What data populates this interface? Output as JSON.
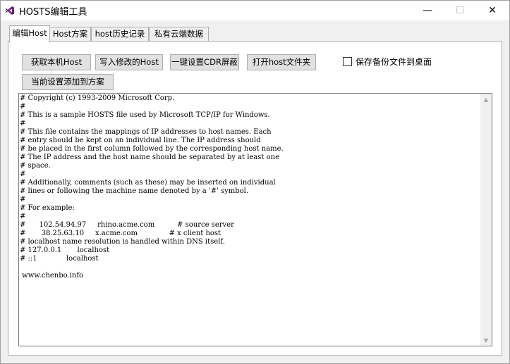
{
  "window": {
    "title": "HOSTS编辑工具",
    "minimize_glyph": "—",
    "maximize_glyph": "☐",
    "close_glyph": "✕"
  },
  "tabs": [
    {
      "label": "编辑Host",
      "active": true
    },
    {
      "label": "Host方案",
      "active": false
    },
    {
      "label": "host历史记录",
      "active": false
    },
    {
      "label": "私有云端数据",
      "active": false
    }
  ],
  "toolbar": {
    "get_local_host": "获取本机Host",
    "write_host": "写入修改的Host",
    "cdr_block": "一键设置CDR屏蔽",
    "open_host_folder": "打开host文件夹",
    "add_to_scheme": "当前设置添加到方案",
    "backup_to_desktop": "保存备份文件到桌面"
  },
  "editor": {
    "content": "# Copyright (c) 1993-2009 Microsoft Corp.\n#\n# This is a sample HOSTS file used by Microsoft TCP/IP for Windows.\n#\n# This file contains the mappings of IP addresses to host names. Each\n# entry should be kept on an individual line. The IP address should\n# be placed in the first column followed by the corresponding host name.\n# The IP address and the host name should be separated by at least one\n# space.\n#\n# Additionally, comments (such as these) may be inserted on individual\n# lines or following the machine name denoted by a '#' symbol.\n#\n# For example:\n#\n#      102.54.94.97     rhino.acme.com          # source server\n#       38.25.63.10     x.acme.com              # x client host\n# localhost name resolution is handled within DNS itself.\n# 127.0.0.1       localhost\n# ::1             localhost\n\n www.chenbo.info"
  },
  "icons": {
    "app": "visual-studio-icon",
    "scroll_up": "▲",
    "scroll_down": "▼"
  },
  "colors": {
    "window_bg": "#f0f0f0",
    "button_bg": "#e1e1e1",
    "border": "#adadad",
    "app_icon": "#68217a"
  }
}
